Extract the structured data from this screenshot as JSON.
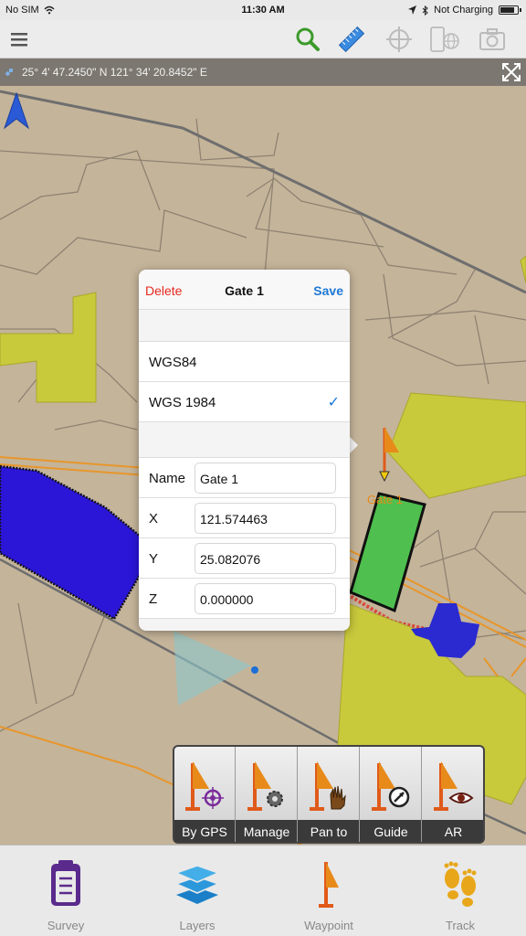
{
  "status_bar": {
    "carrier": "No SIM",
    "time": "11:30 AM",
    "charging": "Not Charging",
    "battery_fraction": 0.85
  },
  "toolbar": {
    "menu_icon": "hamburger-menu-icon",
    "search_icon": "search-icon",
    "measure_icon": "ruler-icon",
    "crosshair_icon": "crosshair-icon",
    "device_icon": "phone-globe-icon",
    "camera_icon": "camera-icon"
  },
  "coordinates": {
    "text": "25° 4' 47.2450\" N 121° 34' 20.8452\" E"
  },
  "map": {
    "waypoint_label": "Gate 1"
  },
  "popup": {
    "delete_label": "Delete",
    "title": "Gate 1",
    "save_label": "Save",
    "datum_options": [
      {
        "label": "WGS84",
        "selected": false
      },
      {
        "label": "WGS 1984",
        "selected": true
      }
    ],
    "check_glyph": "✓",
    "fields": [
      {
        "label": "Name",
        "value": "Gate 1"
      },
      {
        "label": "X",
        "value": "121.574463"
      },
      {
        "label": "Y",
        "value": "25.082076"
      },
      {
        "label": "Z",
        "value": "0.000000"
      }
    ]
  },
  "actions": [
    {
      "label": "By GPS",
      "icon": "flag-gps-icon"
    },
    {
      "label": "Manage",
      "icon": "flag-gear-icon"
    },
    {
      "label": "Pan to",
      "icon": "flag-hand-icon"
    },
    {
      "label": "Guide",
      "icon": "flag-compass-icon"
    },
    {
      "label": "AR",
      "icon": "flag-eye-icon"
    }
  ],
  "tabs": [
    {
      "label": "Survey",
      "icon": "clipboard-icon"
    },
    {
      "label": "Layers",
      "icon": "layers-icon"
    },
    {
      "label": "Waypoint",
      "icon": "flag-icon"
    },
    {
      "label": "Track",
      "icon": "footprints-icon"
    }
  ],
  "colors": {
    "map_background": "#c4b49a",
    "delete_red": "#e6281e",
    "accent_blue": "#1e78d6",
    "waypoint_orange": "#e88a1a",
    "selected_tab_purple": "#5a2a8c"
  }
}
